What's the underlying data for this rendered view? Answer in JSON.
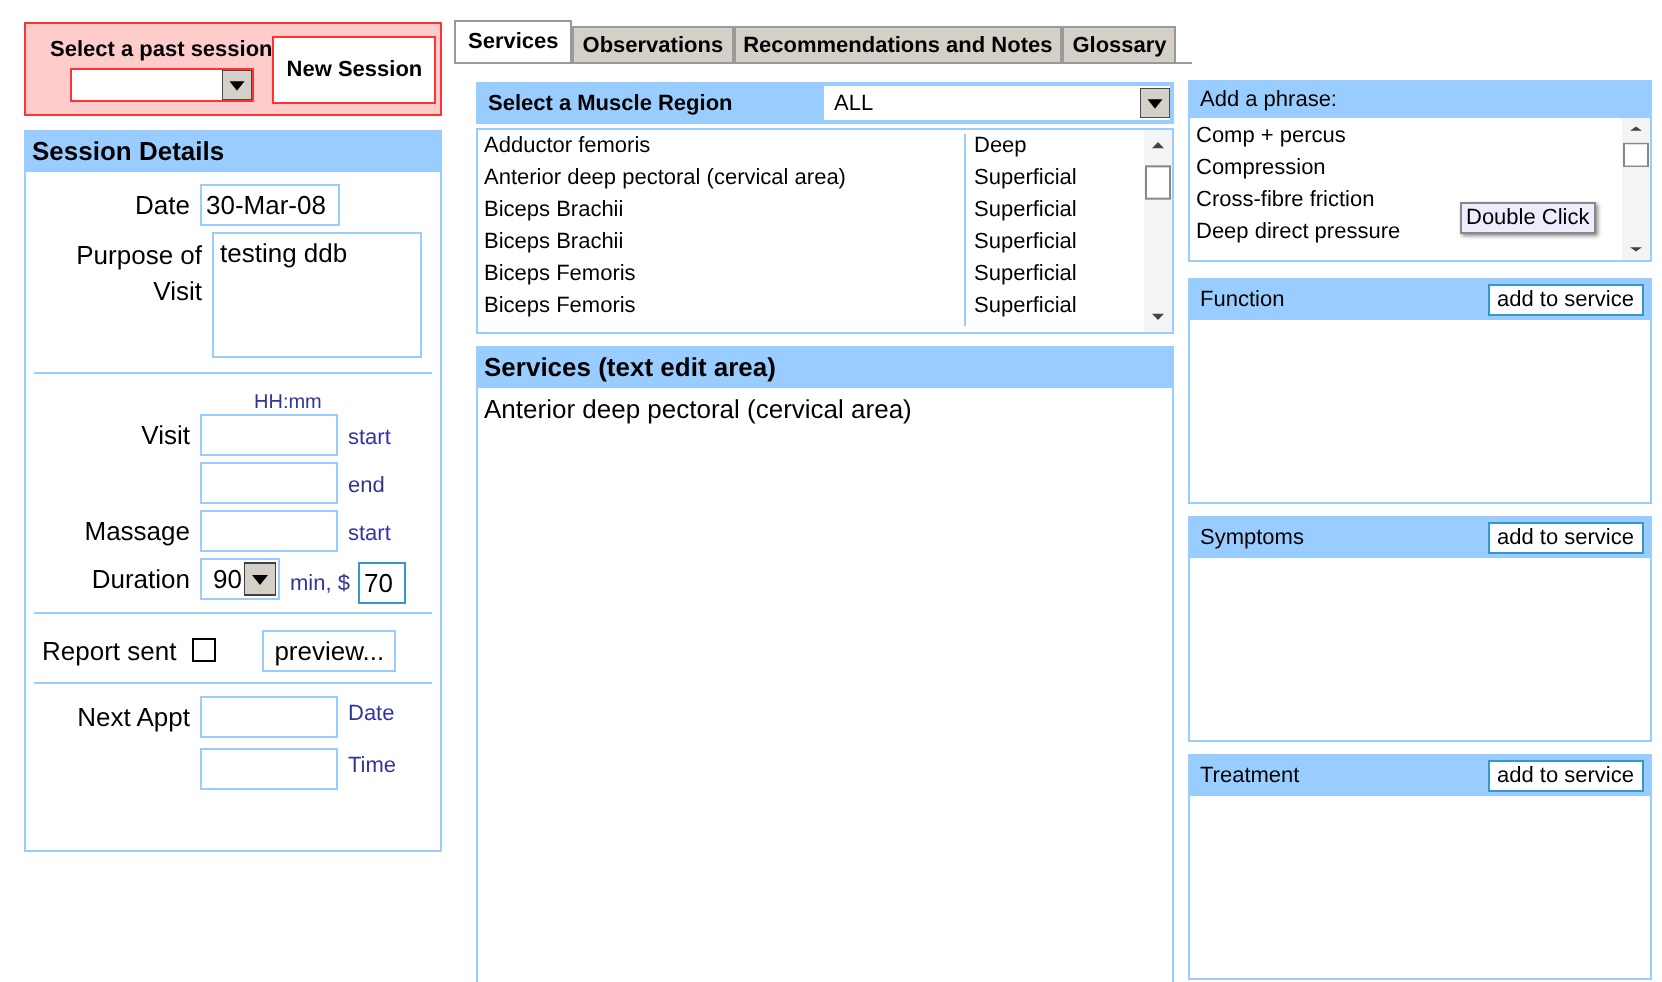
{
  "session_selector": {
    "label": "Select a past session",
    "button": "New Session"
  },
  "session_details": {
    "title": "Session Details",
    "date": {
      "label": "Date",
      "value": "30-Mar-08"
    },
    "purpose": {
      "label": "Purpose of Visit",
      "value": "testing ddb"
    },
    "time_hint": "HH:mm",
    "times": [
      {
        "label": "Visit",
        "unit": "start"
      },
      {
        "unit": "end"
      },
      {
        "label": "Massage",
        "unit": "start"
      }
    ],
    "duration": {
      "label": "Duration",
      "value": "90",
      "unit": "min, $",
      "price": "70"
    },
    "report": {
      "label": "Report sent",
      "checked": false,
      "button": "preview..."
    },
    "next_appt": [
      {
        "label": "Next Appt",
        "unit": "Date"
      },
      {
        "unit": "Time"
      }
    ]
  },
  "tabs": [
    {
      "label": "Services",
      "selected": true
    },
    {
      "label": "Observations",
      "selected": false
    },
    {
      "label": "Recommendations and Notes",
      "selected": false
    },
    {
      "label": "Glossary",
      "selected": false
    }
  ],
  "muscle_region": {
    "label": "Select a Muscle Region",
    "value": "ALL"
  },
  "muscles": [
    {
      "name": "Adductor femoris",
      "depth": "Deep"
    },
    {
      "name": "Anterior deep pectoral (cervical area)",
      "depth": "Superficial"
    },
    {
      "name": "Biceps Brachii",
      "depth": "Superficial"
    },
    {
      "name": "Biceps Brachii",
      "depth": "Superficial"
    },
    {
      "name": "Biceps Femoris",
      "depth": "Superficial"
    },
    {
      "name": "Biceps Femoris",
      "depth": "Superficial"
    }
  ],
  "services_edit": {
    "title": "Services (text edit area)",
    "text": "Anterior deep pectoral (cervical area)"
  },
  "phrases": {
    "title": "Add a phrase:",
    "items": [
      "Comp + percus",
      "Compression",
      "Cross-fibre friction",
      "Deep direct pressure"
    ],
    "tooltip": "Double Click"
  },
  "notes": [
    {
      "title": "Function",
      "button": "add to service"
    },
    {
      "title": "Symptoms",
      "button": "add to service"
    },
    {
      "title": "Treatment",
      "button": "add to service"
    }
  ]
}
